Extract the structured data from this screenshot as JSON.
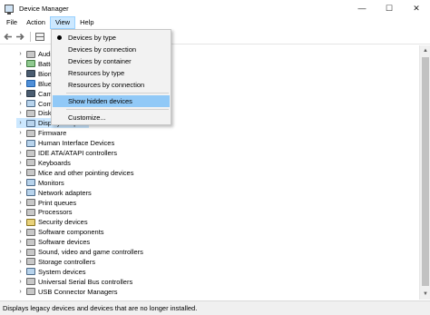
{
  "window": {
    "title": "Device Manager",
    "controls": {
      "minimize": "—",
      "maximize": "☐",
      "close": "✕"
    }
  },
  "menubar": {
    "items": [
      {
        "label": "File"
      },
      {
        "label": "Action"
      },
      {
        "label": "View"
      },
      {
        "label": "Help"
      }
    ],
    "active": "View"
  },
  "toolbar": {
    "buttons": [
      "back-arrow-icon",
      "forward-arrow-icon",
      "properties-grid-icon"
    ]
  },
  "tree": {
    "rows": [
      {
        "label": "Audio inputs and outputs",
        "icon": "audio-icon",
        "color": "gray"
      },
      {
        "label": "Batteries",
        "icon": "battery-icon",
        "color": "green"
      },
      {
        "label": "Biometric devices",
        "icon": "biometric-icon",
        "color": "dark"
      },
      {
        "label": "Bluetooth",
        "icon": "bluetooth-icon",
        "color": "blue"
      },
      {
        "label": "Cameras",
        "icon": "camera-icon",
        "color": "dark"
      },
      {
        "label": "Computer",
        "icon": "computer-icon",
        "color": "normal"
      },
      {
        "label": "Disk drives",
        "icon": "disk-icon",
        "color": "gray"
      },
      {
        "label": "Display adapters",
        "icon": "display-icon",
        "color": "normal"
      },
      {
        "label": "Firmware",
        "icon": "firmware-icon",
        "color": "gray"
      },
      {
        "label": "Human Interface Devices",
        "icon": "hid-icon",
        "color": "normal"
      },
      {
        "label": "IDE ATA/ATAPI controllers",
        "icon": "ide-icon",
        "color": "gray"
      },
      {
        "label": "Keyboards",
        "icon": "keyboard-icon",
        "color": "gray"
      },
      {
        "label": "Mice and other pointing devices",
        "icon": "mouse-icon",
        "color": "gray"
      },
      {
        "label": "Monitors",
        "icon": "monitor-icon",
        "color": "normal"
      },
      {
        "label": "Network adapters",
        "icon": "network-icon",
        "color": "normal"
      },
      {
        "label": "Print queues",
        "icon": "printer-icon",
        "color": "gray"
      },
      {
        "label": "Processors",
        "icon": "processor-icon",
        "color": "gray"
      },
      {
        "label": "Security devices",
        "icon": "security-icon",
        "color": "yellow"
      },
      {
        "label": "Software components",
        "icon": "software-component-icon",
        "color": "gray"
      },
      {
        "label": "Software devices",
        "icon": "software-device-icon",
        "color": "gray"
      },
      {
        "label": "Sound, video and game controllers",
        "icon": "sound-icon",
        "color": "gray"
      },
      {
        "label": "Storage controllers",
        "icon": "storage-icon",
        "color": "gray"
      },
      {
        "label": "System devices",
        "icon": "system-icon",
        "color": "normal"
      },
      {
        "label": "Universal Serial Bus controllers",
        "icon": "usb-icon",
        "color": "gray"
      },
      {
        "label": "USB Connector Managers",
        "icon": "usb-connector-icon",
        "color": "gray"
      }
    ]
  },
  "view_menu": {
    "items": [
      {
        "label": "Devices by type",
        "checked": true
      },
      {
        "label": "Devices by connection"
      },
      {
        "label": "Devices by container"
      },
      {
        "label": "Resources by type"
      },
      {
        "label": "Resources by connection"
      },
      {
        "label": "Show hidden devices",
        "highlighted": true
      },
      {
        "label": "Customize..."
      }
    ]
  },
  "status": {
    "text": "Displays legacy devices and devices that are no longer installed."
  },
  "colors": {
    "menu_highlight": "#91c9f7",
    "menu_active": "#cce8ff",
    "selection": "#cce8ff"
  }
}
